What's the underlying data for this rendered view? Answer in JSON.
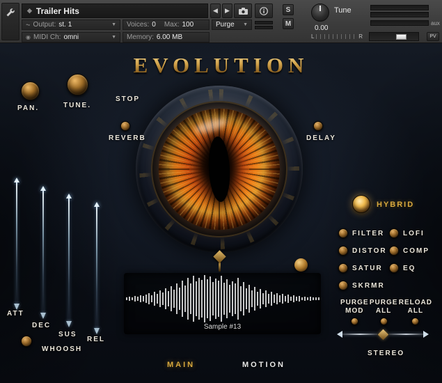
{
  "header": {
    "title": "Trailer Hits",
    "instrument_icon": "◆",
    "nav_back": "◀",
    "nav_forward": "▶",
    "dropdown_arrow": "▼",
    "solo": "S",
    "mute": "M",
    "tune_label": "Tune",
    "tune_value": "0.00",
    "output_label": "Output:",
    "output_value": "st. 1",
    "voices_label": "Voices:",
    "voices_value": "0",
    "max_label": "Max:",
    "max_value": "100",
    "purge_label": "Purge",
    "midi_label": "MIDI Ch:",
    "midi_value": "omni",
    "memory_label": "Memory:",
    "memory_value": "6.00 MB",
    "aux": "aux",
    "pv": "PV",
    "pan_left": "L",
    "pan_right": "R"
  },
  "instrument": {
    "title": "EVOLUTION",
    "pan_knob": "PAN.",
    "tune_knob": "TUNE.",
    "stop": "STOP",
    "reverb": "REVERB",
    "delay": "DELAY",
    "hybrid": "HYBRID",
    "fx_left": [
      "FILTER",
      "DISTOR",
      "SATUR",
      "SKRMR"
    ],
    "fx_right": [
      "LOFI",
      "COMP",
      "EQ"
    ],
    "purge_group": [
      {
        "line1": "PURGE",
        "line2": "MOD"
      },
      {
        "line1": "PURGE",
        "line2": "ALL"
      },
      {
        "line1": "RELOAD",
        "line2": "ALL"
      }
    ],
    "envelope": [
      "ATT",
      "DEC",
      "SUS",
      "REL"
    ],
    "whoosh": "WHOOSH",
    "stereo": "STEREO",
    "sample_name": "Sample #13",
    "tabs": [
      {
        "label": "MAIN",
        "active": true
      },
      {
        "label": "MOTION",
        "active": false
      }
    ]
  },
  "colors": {
    "gold": "#d8a93f",
    "gold_bright": "#f0d287",
    "background": "#0b0f16",
    "header_bg": "#3d3d3d",
    "iris_orange": "#f08018"
  },
  "waveform": [
    2,
    3,
    2,
    4,
    3,
    5,
    4,
    6,
    8,
    5,
    10,
    7,
    12,
    9,
    15,
    11,
    18,
    13,
    22,
    16,
    26,
    19,
    30,
    22,
    33,
    25,
    30,
    27,
    34,
    28,
    32,
    24,
    29,
    26,
    33,
    23,
    28,
    20,
    25,
    22,
    30,
    18,
    24,
    15,
    20,
    12,
    17,
    10,
    14,
    8,
    12,
    7,
    10,
    6,
    8,
    5,
    7,
    4,
    6,
    3,
    5,
    3,
    4,
    2,
    3,
    2,
    3,
    2,
    2,
    2
  ]
}
